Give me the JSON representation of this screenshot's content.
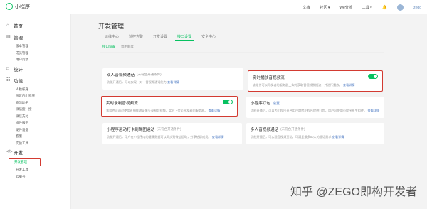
{
  "topbar": {
    "app_name": "小程序",
    "nav": [
      "文档",
      "社区 ▾",
      "We分析",
      "工具 ▾"
    ],
    "username": "zego"
  },
  "sidebar": {
    "sections": [
      {
        "label": "首页",
        "icon": "home-icon",
        "items": []
      },
      {
        "label": "管理",
        "icon": "folder-icon",
        "items": [
          "版本管理",
          "成员管理",
          "用户反馈"
        ]
      },
      {
        "label": "统计",
        "icon": "chart-icon",
        "items": []
      },
      {
        "label": "功能",
        "icon": "grid-icon",
        "items": [
          "人脸核身",
          "附近的小程序",
          "物流助手",
          "微信搜一搜",
          "微信支付",
          "插件服务",
          "硬件设备",
          "客服",
          "实验工具"
        ]
      },
      {
        "label": "开发",
        "icon": "code-icon",
        "items": [
          "开发管理",
          "开发工具",
          "云服务"
        ]
      }
    ],
    "active_item": "开发管理"
  },
  "main": {
    "title": "开发管理",
    "tabs": [
      "运维中心",
      "监控告警",
      "开发设置",
      "接口设置",
      "安全中心"
    ],
    "active_tab": "接口设置",
    "subtabs": [
      "接口设置",
      "调用额度"
    ],
    "active_subtab": "接口设置",
    "cards": [
      {
        "title": "双人音视频通话",
        "note": "(未符合开通条件)",
        "desc": "功能开通后，可以实现一对一音视频通话能力",
        "link": "查看详情"
      },
      {
        "title": "实时播放音视频流",
        "note": "",
        "desc": "该组件可以开发者的服务器上实时获取音视频数据流，并进行播放。",
        "link": "查看详情",
        "toggle": true
      },
      {
        "title": "实时录制音视频流",
        "note": "",
        "desc": "该组件可通过使用直播推流录像头录制音视频，实时上传至开发者的服务器。",
        "link": "查看详情",
        "toggle": true
      },
      {
        "title": "小程序打包",
        "note": "",
        "desc": "功能开通后，可以为小程序开启用户跳转小程序提供打包，用户可使用小程序原生组件。",
        "link": "查看详情",
        "title_link": "设置"
      },
      {
        "title": "小程序运动打卡到群团运动",
        "note": "(未符合开通条件)",
        "desc": "功能开通后，用户在小程序内的健康数据可以同步到微信运动，分享给群成员。",
        "link": "查看详情"
      },
      {
        "title": "多人音视频通话",
        "note": "(未符合开通条件)",
        "desc": "功能开通后，可实现音视频互动，可满足最多50人的通话需求",
        "link": "查看详情"
      }
    ]
  },
  "watermark": "知乎 @ZEGO即构开发者",
  "colors": {
    "accent": "#07c160",
    "highlight": "#d33b32",
    "link": "#4a78c2"
  }
}
